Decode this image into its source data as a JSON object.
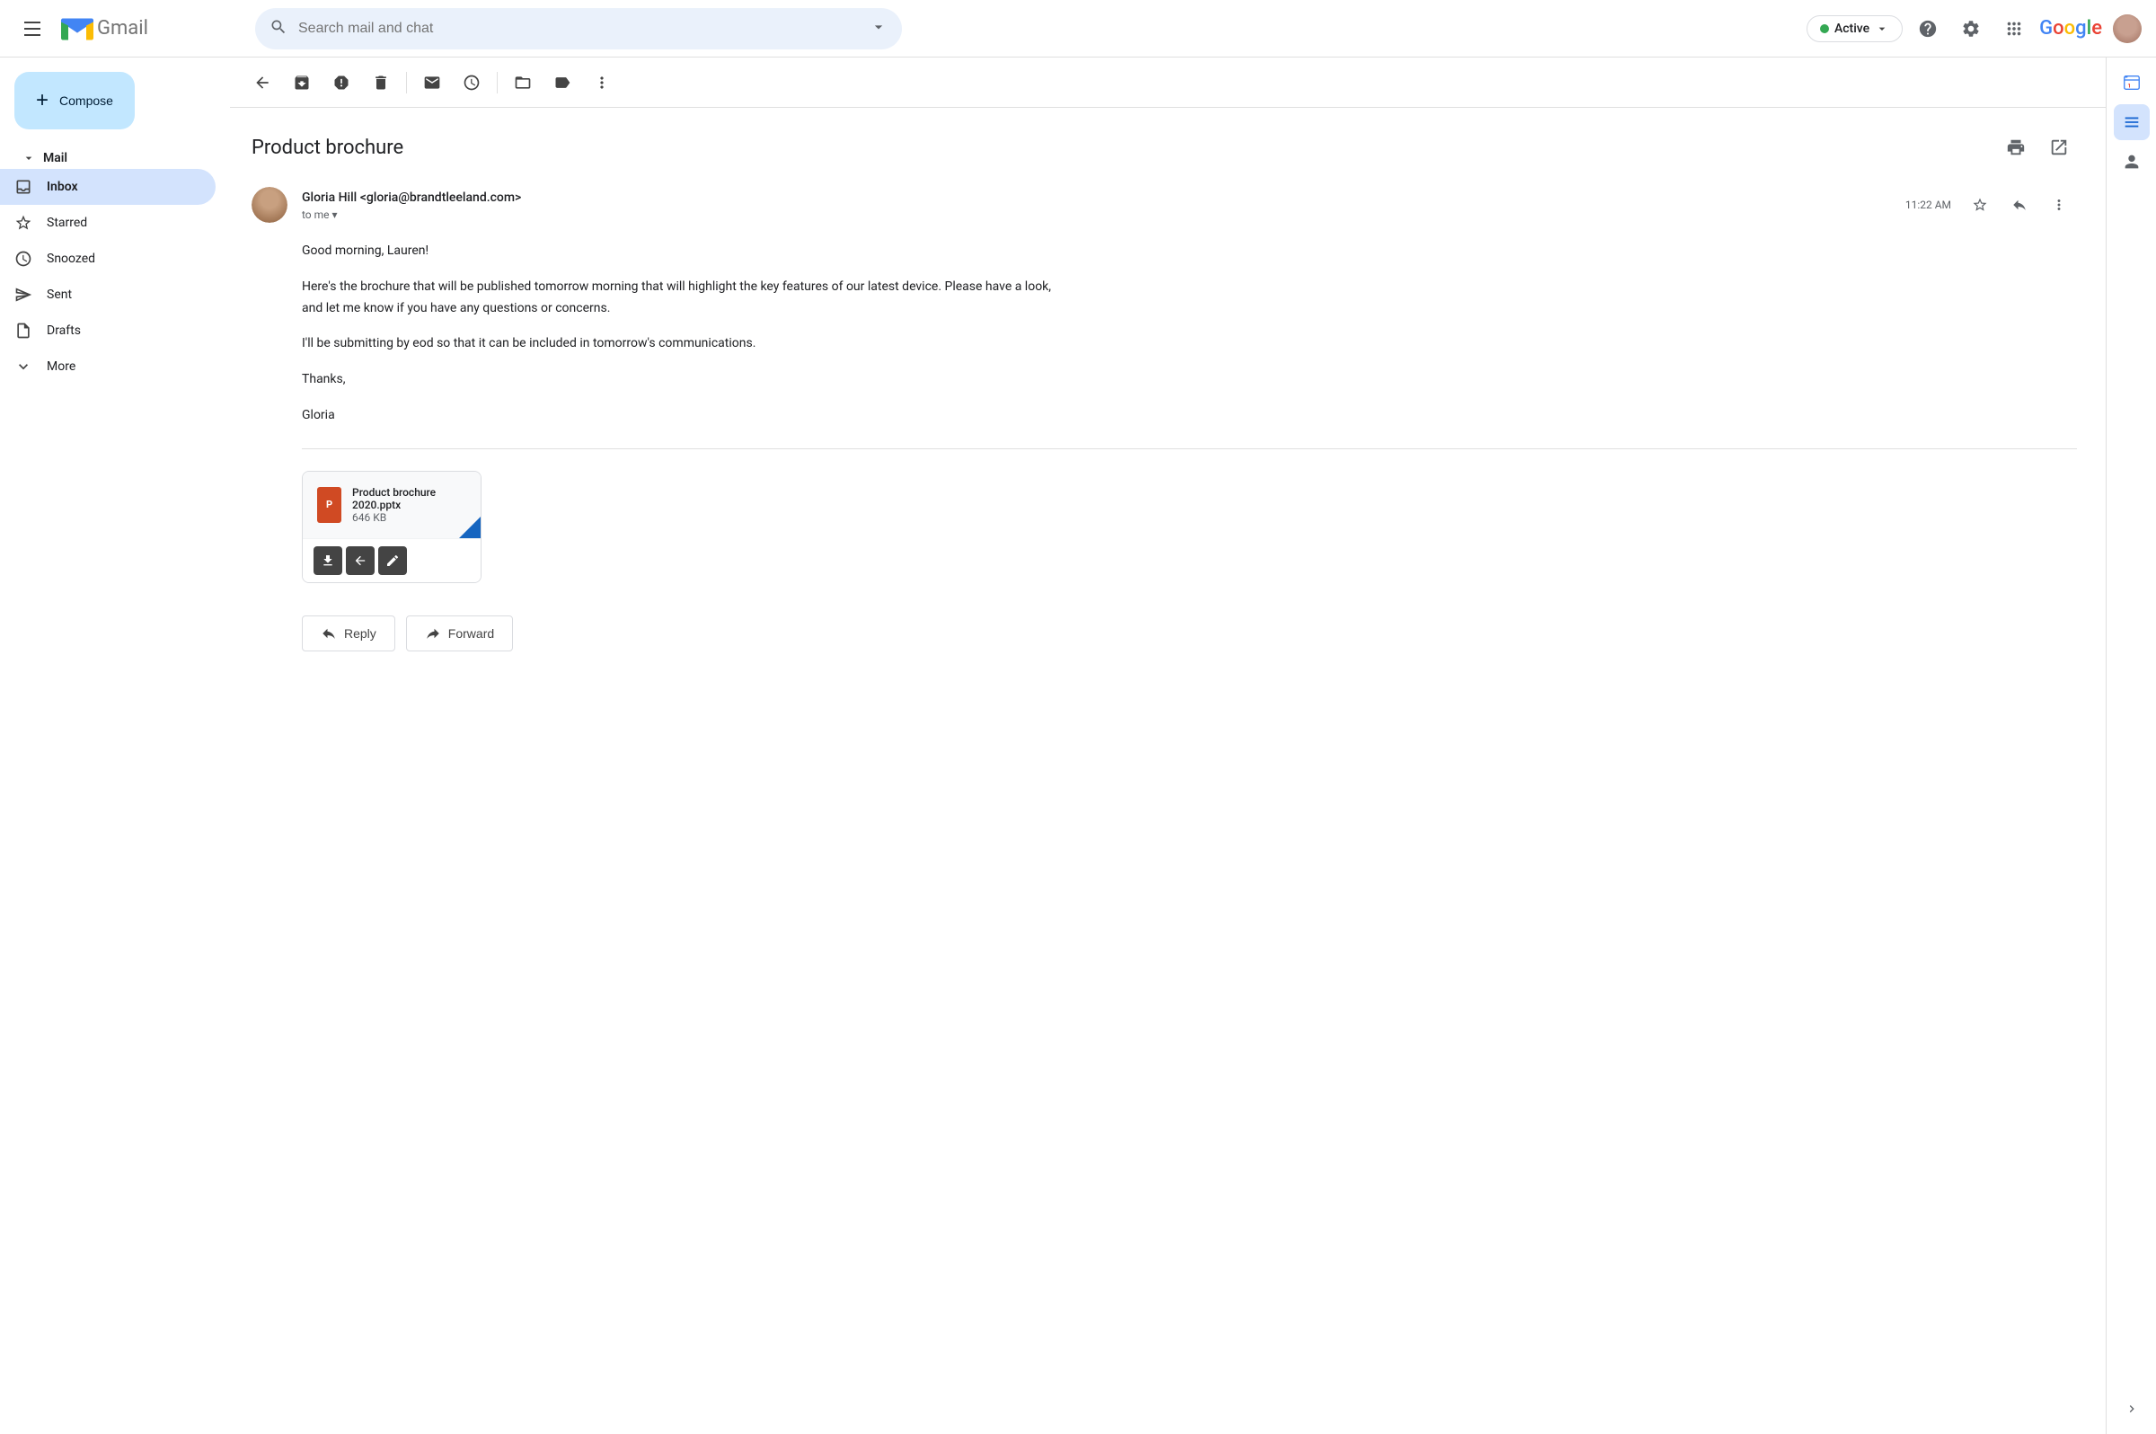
{
  "app": {
    "title": "Gmail",
    "logo_text": "Gmail"
  },
  "topbar": {
    "search_placeholder": "Search mail and chat",
    "active_label": "Active",
    "active_status": "active",
    "help_tooltip": "Help",
    "settings_tooltip": "Settings",
    "apps_tooltip": "Google apps"
  },
  "sidebar": {
    "mail_section": "Mail",
    "compose_label": "Compose",
    "nav_items": [
      {
        "id": "inbox",
        "label": "Inbox",
        "icon": "inbox-icon",
        "active": true
      },
      {
        "id": "starred",
        "label": "Starred",
        "icon": "star-icon",
        "active": false
      },
      {
        "id": "snoozed",
        "label": "Snoozed",
        "icon": "clock-icon",
        "active": false
      },
      {
        "id": "sent",
        "label": "Sent",
        "icon": "send-icon",
        "active": false
      },
      {
        "id": "drafts",
        "label": "Drafts",
        "icon": "draft-icon",
        "active": false
      },
      {
        "id": "more",
        "label": "More",
        "icon": "chevron-down-icon",
        "active": false
      }
    ]
  },
  "toolbar": {
    "back_tooltip": "Back",
    "archive_tooltip": "Archive",
    "spam_tooltip": "Report spam",
    "delete_tooltip": "Delete",
    "mark_tooltip": "Mark as unread",
    "snooze_tooltip": "Snooze",
    "move_tooltip": "Move to",
    "label_tooltip": "Label",
    "more_tooltip": "More"
  },
  "email": {
    "subject": "Product brochure",
    "print_tooltip": "Print",
    "new_window_tooltip": "Open in new window",
    "sender_name": "Gloria Hill",
    "sender_email": "gloria@brandtleeland.com",
    "sender_display": "Gloria Hill <gloria@brandtleeland.com>",
    "to_label": "to me",
    "timestamp": "11:22 AM",
    "star_tooltip": "Starred",
    "reply_tooltip": "Reply",
    "more_tooltip": "More",
    "body_lines": [
      "Good morning, Lauren!",
      "Here's the brochure that will be published tomorrow morning that will highlight the key features of our latest device. Please have a look, and let me know if you have any questions or concerns.",
      "I'll be submitting by eod so that it can be included in tomorrow's communications.",
      "Thanks,",
      "Gloria"
    ],
    "attachment": {
      "name": "Product brochure 2020.pptx",
      "size": "646 KB",
      "type": "pptx",
      "type_label": "P",
      "download_tooltip": "Download",
      "save_drive_tooltip": "Save to Drive",
      "edit_tooltip": "Edit"
    },
    "reply_btn": "Reply",
    "forward_btn": "Forward"
  },
  "right_panel": {
    "expand_label": ">",
    "panels": [
      {
        "id": "calendar",
        "icon": "calendar-icon",
        "active": false
      },
      {
        "id": "tasks",
        "icon": "tasks-icon",
        "active": true
      },
      {
        "id": "contacts",
        "icon": "contacts-icon",
        "active": false
      }
    ]
  }
}
